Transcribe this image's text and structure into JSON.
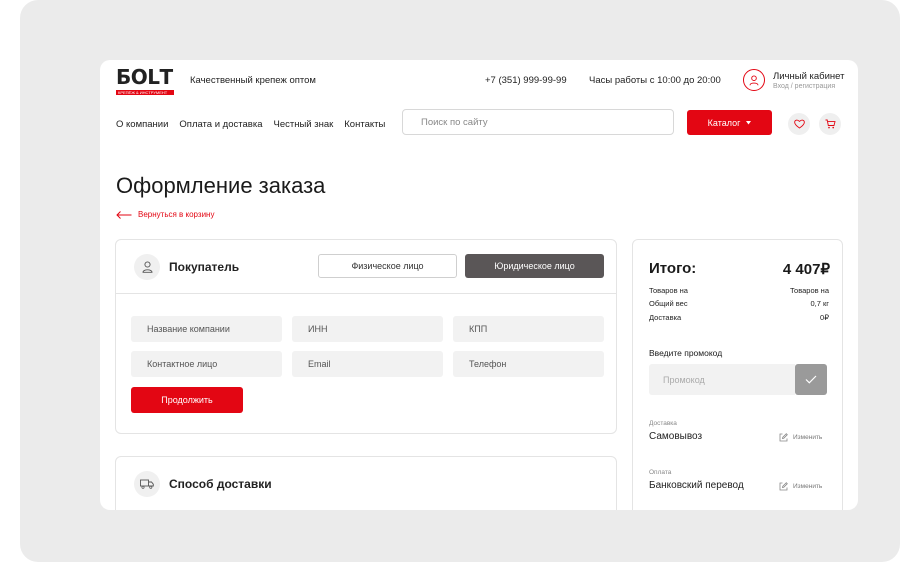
{
  "header": {
    "logo_text": "БОLТ",
    "logo_sub": "КРЕПЁЖ & ИНСТРУМЕНТ",
    "tagline": "Качественный крепеж оптом",
    "phone": "+7 (351) 999-99-99",
    "hours": "Часы работы с 10:00 до 20:00",
    "account_title": "Личный кабинет",
    "account_sub": "Вход / регистрация"
  },
  "nav": {
    "items": [
      {
        "label": "О компании"
      },
      {
        "label": "Оплата и доставка"
      },
      {
        "label": "Честный знак"
      },
      {
        "label": "Контакты"
      }
    ],
    "search_placeholder": "Поиск по сайту",
    "catalog_label": "Каталог"
  },
  "page": {
    "title": "Оформление заказа",
    "back_label": "Вернуться в корзину"
  },
  "buyer": {
    "title": "Покупатель",
    "type_individual": "Физическое лицо",
    "type_legal": "Юридическое лицо",
    "fields": {
      "company": "Название компании",
      "inn": "ИНН",
      "kpp": "КПП",
      "contact": "Контактное лицо",
      "email": "Email",
      "phone": "Телефон"
    },
    "continue_label": "Продолжить"
  },
  "delivery_section": {
    "title": "Способ доставки"
  },
  "summary": {
    "title": "Итого:",
    "total": "4 407₽",
    "rows": [
      {
        "label": "Товаров на",
        "value": "Товаров на"
      },
      {
        "label": "Общий вес",
        "value": "0,7 кг"
      },
      {
        "label": "Доставка",
        "value": "0₽"
      }
    ],
    "promo_label": "Введите промокод",
    "promo_placeholder": "Промокод",
    "delivery_label": "Доставка",
    "delivery_value": "Самовывоз",
    "payment_label": "Оплата",
    "payment_value": "Банковский перевод",
    "change_label": "Изменить"
  },
  "colors": {
    "accent": "#e30613",
    "dark_button": "#5a5657",
    "field_bg": "#f2f2f2"
  }
}
